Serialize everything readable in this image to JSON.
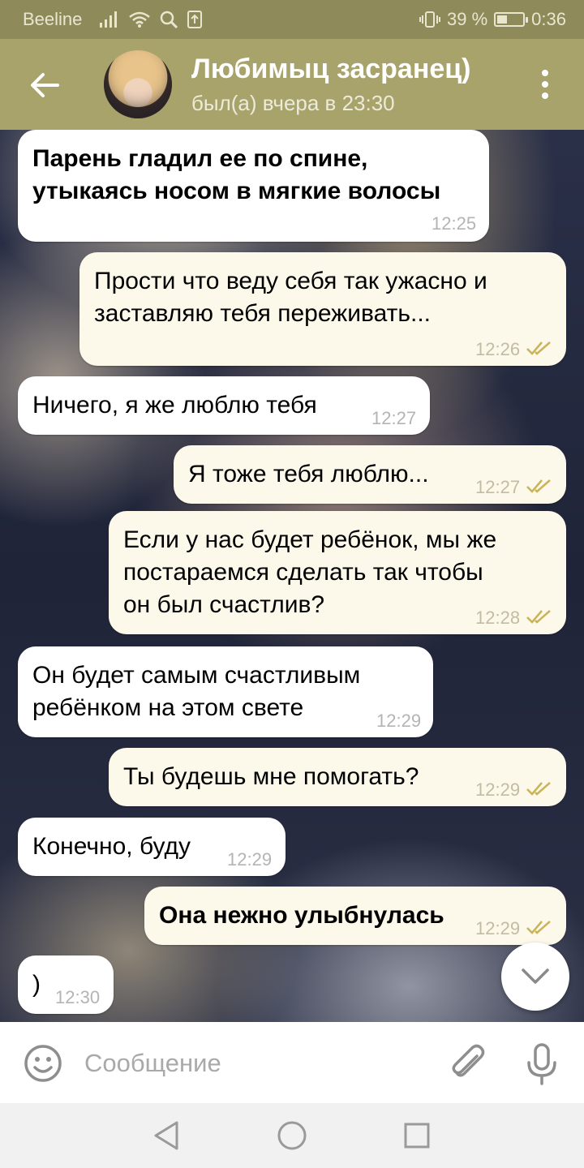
{
  "status_bar": {
    "carrier": "Beeline",
    "battery_text": "39 %",
    "battery_level": 0.39,
    "time": "0:36",
    "icons": [
      "signal-icon",
      "wifi-icon",
      "search-icon",
      "upload-icon",
      "vibrate-icon",
      "battery-icon"
    ]
  },
  "header": {
    "title": "Любимыц засранец)",
    "subtitle": "был(а) вчера в 23:30",
    "icons": [
      "back-arrow-icon",
      "avatar",
      "more-vertical-icon"
    ]
  },
  "messages": [
    {
      "direction": "in",
      "text": "Парень гладил ее по спине,\nутыкаясь носом в мягкие волосы",
      "bold": true,
      "time": "12:25"
    },
    {
      "direction": "out",
      "text": "Прости что веду себя так ужасно и\nзаставляю тебя переживать...",
      "bold": false,
      "time": "12:26",
      "read": true
    },
    {
      "direction": "in",
      "text": "Ничего, я же люблю тебя",
      "bold": false,
      "time": "12:27"
    },
    {
      "direction": "out",
      "text": "Я тоже тебя люблю...",
      "bold": false,
      "time": "12:27",
      "read": true
    },
    {
      "direction": "out",
      "text": "Если у нас будет ребёнок, мы же\nпостараемся сделать так чтобы\nон был счастлив?",
      "bold": false,
      "time": "12:28",
      "read": true
    },
    {
      "direction": "in",
      "text": "Он будет самым счастливым\nребёнком на этом свете",
      "bold": false,
      "time": "12:29"
    },
    {
      "direction": "out",
      "text": "Ты будешь мне помогать?",
      "bold": false,
      "time": "12:29",
      "read": true
    },
    {
      "direction": "in",
      "text": "Конечно, буду",
      "bold": false,
      "time": "12:29"
    },
    {
      "direction": "out",
      "text": "Она нежно улыбнулась",
      "bold": true,
      "time": "12:29",
      "read": true
    },
    {
      "direction": "in",
      "text": ")",
      "bold": false,
      "time": "12:30"
    }
  ],
  "input": {
    "placeholder": "Сообщение",
    "value": ""
  },
  "colors": {
    "status_bar_bg": "#8f8a5a",
    "header_bg": "#a8a26b",
    "incoming_bubble": "#ffffff",
    "outgoing_bubble": "#fcf8ea",
    "read_check": "#c9b45a"
  }
}
